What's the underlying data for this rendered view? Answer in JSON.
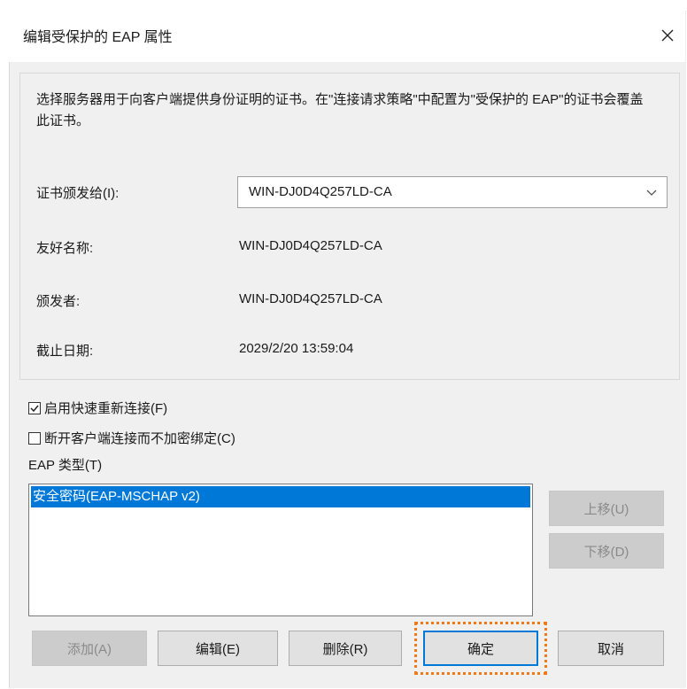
{
  "dialog": {
    "title": "编辑受保护的 EAP 属性",
    "close_icon": "close-icon"
  },
  "panel": {
    "description": "选择服务器用于向客户端提供身份证明的证书。在\"连接请求策略\"中配置为\"受保护的 EAP\"的证书会覆盖此证书。",
    "cert_issued_to_label": "证书颁发给(I):",
    "cert_issued_to_value": "WIN-DJ0D4Q257LD-CA",
    "friendly_name_label": "友好名称:",
    "friendly_name_value": "WIN-DJ0D4Q257LD-CA",
    "issuer_label": "颁发者:",
    "issuer_value": "WIN-DJ0D4Q257LD-CA",
    "expiry_label": "截止日期:",
    "expiry_value": "2029/2/20 13:59:04"
  },
  "options": {
    "fast_reconnect_label": "启用快速重新连接(F)",
    "fast_reconnect_checked": true,
    "disconnect_label": "断开客户端连接而不加密绑定(C)",
    "disconnect_checked": false
  },
  "eap": {
    "label": "EAP 类型(T)",
    "items": [
      "安全密码(EAP-MSCHAP v2)"
    ],
    "selected_index": 0,
    "move_up_label": "上移(U)",
    "move_down_label": "下移(D)"
  },
  "footer": {
    "add_label": "添加(A)",
    "edit_label": "编辑(E)",
    "delete_label": "删除(R)",
    "ok_label": "确定",
    "cancel_label": "取消"
  },
  "colors": {
    "accent": "#0078d7",
    "highlight": "#f07a1a"
  }
}
